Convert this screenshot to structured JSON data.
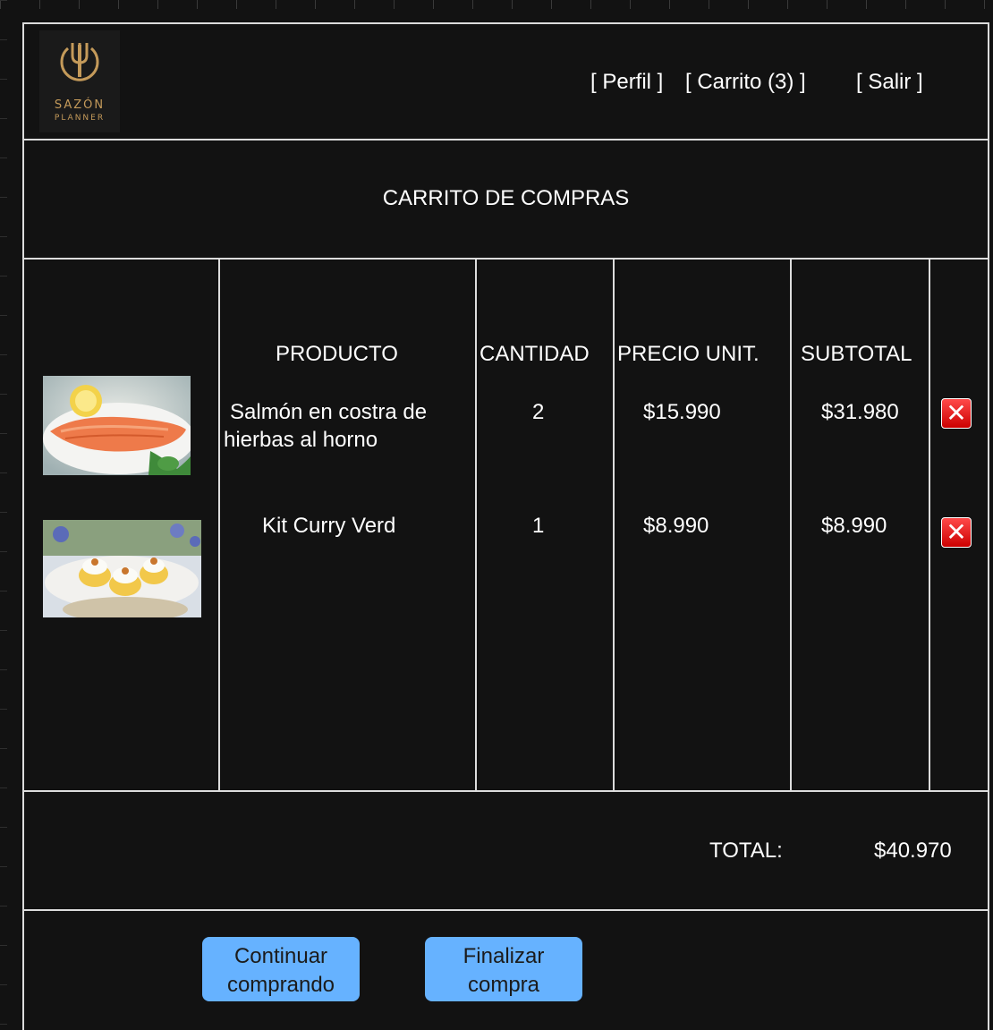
{
  "brand": {
    "line1": "SAZÓN",
    "line2": "PLANNER",
    "color": "#c49a5a"
  },
  "nav": {
    "profile": "[ Perfil ]",
    "cart": "[ Carrito (3) ]",
    "logout": "[ Salir ]"
  },
  "page": {
    "title": "CARRITO DE COMPRAS"
  },
  "table": {
    "headers": {
      "product": "PRODUCTO",
      "quantity": "CANTIDAD",
      "unit_price": "PRECIO UNIT.",
      "subtotal": "SUBTOTAL"
    },
    "rows": [
      {
        "image": "salmon-dish-photo",
        "name_line1": "Salmón en costra  de",
        "name_line2": "hierbas al horno",
        "quantity": "2",
        "unit_price": "$15.990",
        "subtotal": "$31.980",
        "remove_icon": "close-x-icon"
      },
      {
        "image": "curry-kit-photo",
        "name_line1": "Kit Curry Verd",
        "quantity": "1",
        "unit_price": "$8.990",
        "subtotal": "$8.990",
        "remove_icon": "close-x-icon"
      }
    ]
  },
  "summary": {
    "total_label": "TOTAL:",
    "total_value": "$40.970"
  },
  "actions": {
    "continue_line1": "Continuar",
    "continue_line2": "comprando",
    "checkout_line1": "Finalizar",
    "checkout_line2": "compra"
  },
  "colors": {
    "background": "#121212",
    "border": "#dcdcdc",
    "button": "#66b2ff",
    "delete": "#e01b1b"
  }
}
